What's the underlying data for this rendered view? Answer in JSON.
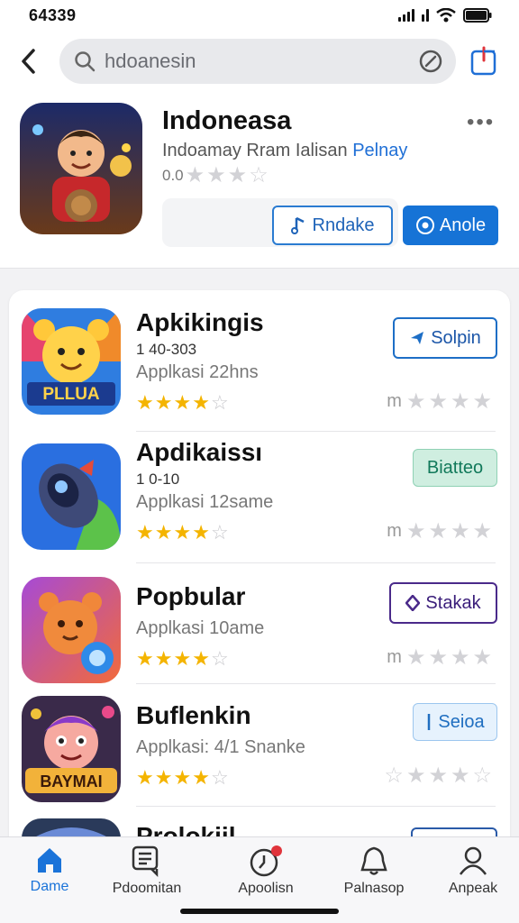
{
  "status_bar": {
    "time": "64339"
  },
  "search": {
    "query": "hdoanesin"
  },
  "featured": {
    "title": "Indoneasa",
    "subtitle_main": "Indoamay Rram Ialisan",
    "subtitle_accent": "Pelnay",
    "rating_text": "0.0",
    "rating_stars": 3,
    "secondary_button": "Rndake",
    "primary_button": "Anole",
    "accent_color": "#1673d6"
  },
  "apps": [
    {
      "name": "Apkikingis",
      "meta": "1 40-303",
      "subtitle": "Applkasi 22hns",
      "stars": 4,
      "right_prefix": "m",
      "button": "Solpin",
      "button_style": "outline-blue",
      "icon": "bear-game-icon",
      "icon_text": "PLLUA"
    },
    {
      "name": "Apdikaissı",
      "meta": "1 0-10",
      "subtitle": "Applkasi 12same",
      "stars": 4,
      "right_prefix": "m",
      "button": "Biatteo",
      "button_style": "teal",
      "icon": "rocket-icon"
    },
    {
      "name": "Popbular",
      "meta": "",
      "subtitle": "Applkasi 10ame",
      "stars": 4,
      "right_prefix": "m",
      "button": "Stakak",
      "button_style": "outline-purple",
      "icon": "teddy-bear-icon"
    },
    {
      "name": "Buflenkin",
      "meta": "",
      "subtitle": "Applkasi: 4/1 Snanke",
      "stars": 4,
      "right_prefix": "",
      "button": "Seioa",
      "button_style": "light-blue",
      "icon": "cartoon-face-icon",
      "icon_text": "BAYMAI"
    },
    {
      "name": "Prolokiil",
      "button_style": "outline-navy",
      "icon": "partial-app-icon"
    }
  ],
  "tabs": [
    {
      "label": "Dame",
      "icon": "house-icon",
      "active": true
    },
    {
      "label": "Pdoomitan",
      "icon": "chat-list-icon",
      "active": false
    },
    {
      "label": "Apoolisn",
      "icon": "clock-badge-icon",
      "active": false
    },
    {
      "label": "Palnasop",
      "icon": "bell-icon",
      "active": false
    },
    {
      "label": "Anpeak",
      "icon": "person-icon",
      "active": false
    }
  ]
}
